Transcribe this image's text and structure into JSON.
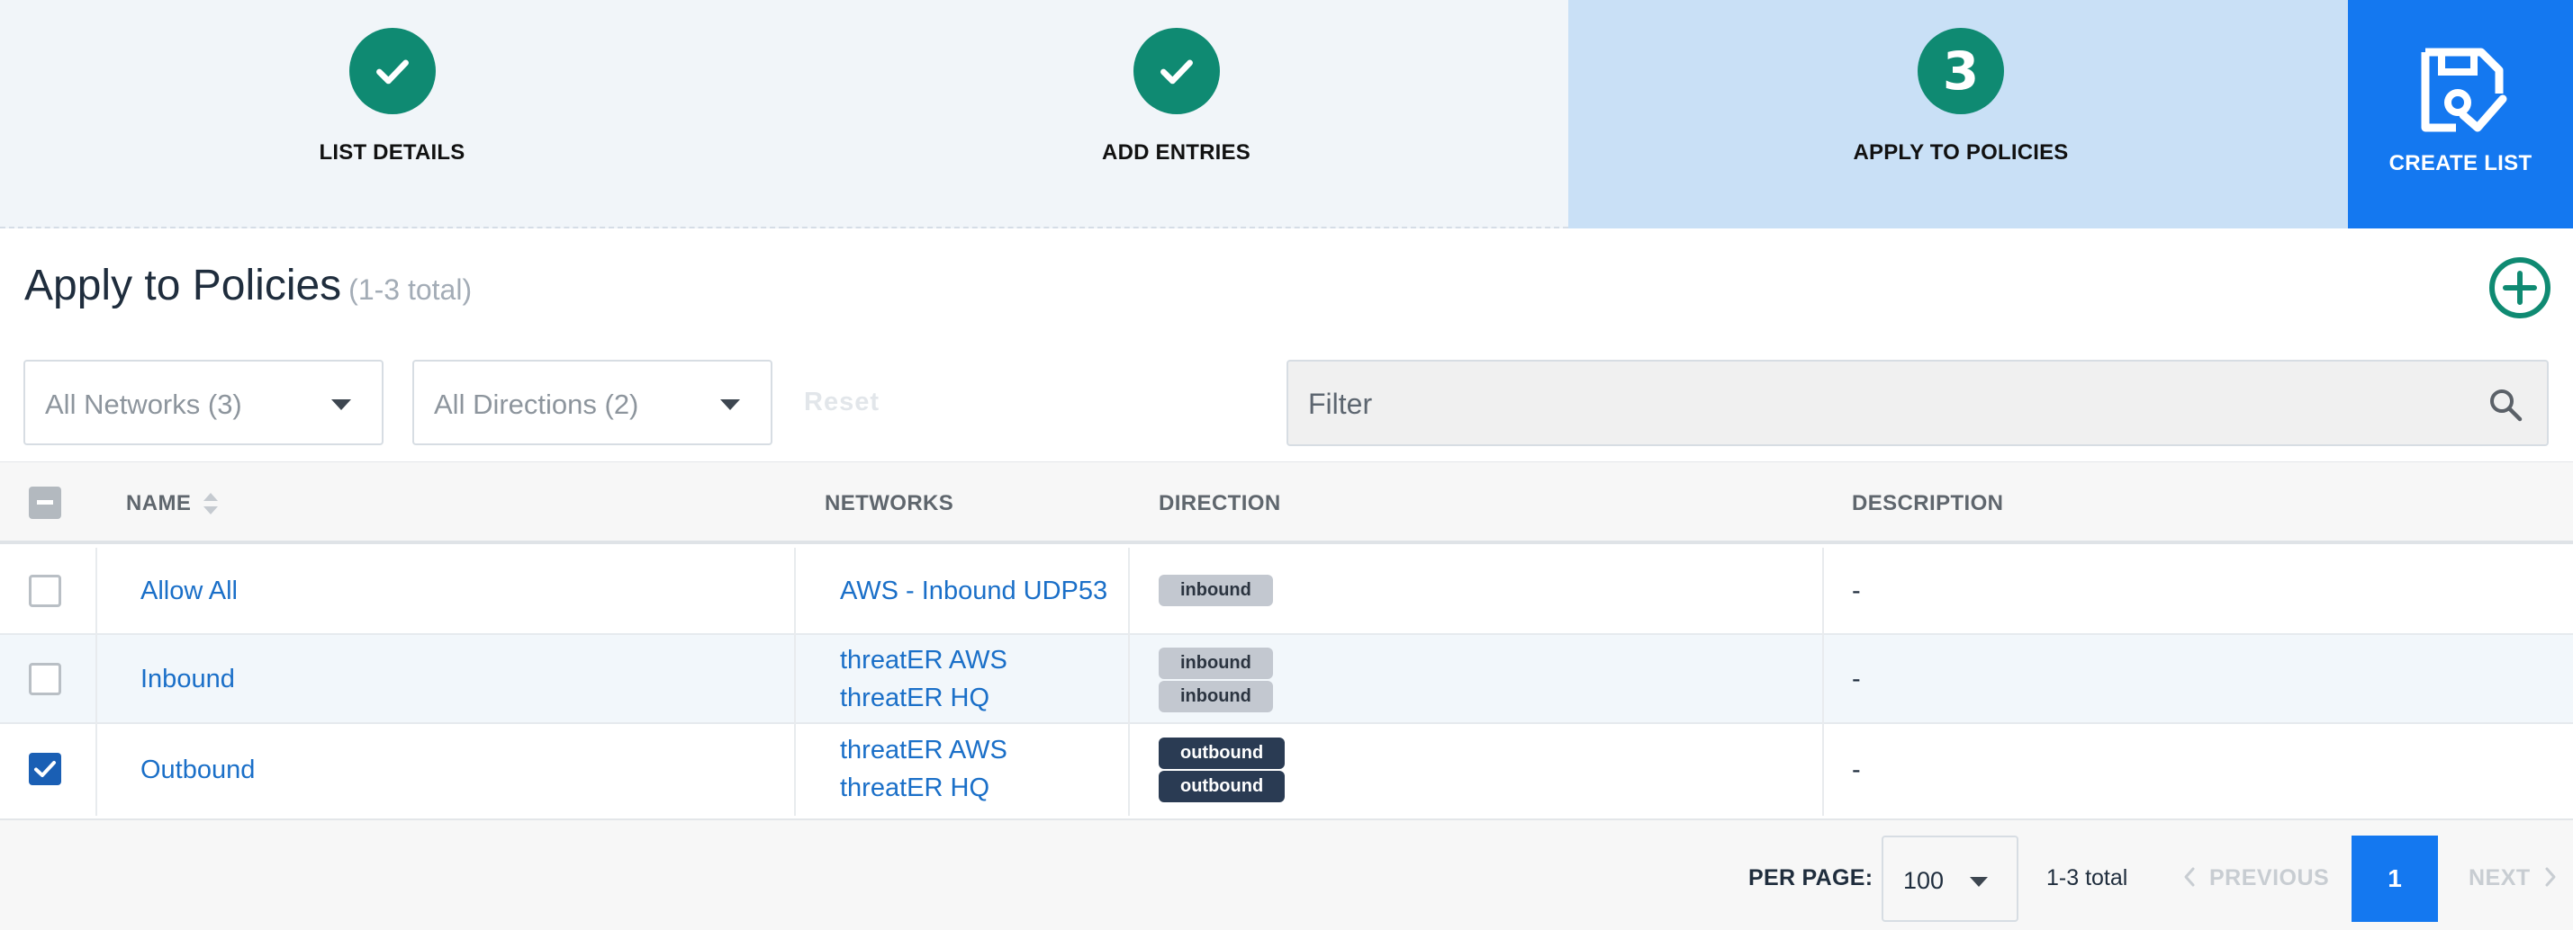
{
  "stepper": {
    "steps": [
      {
        "label": "LIST DETAILS",
        "state": "complete"
      },
      {
        "label": "ADD ENTRIES",
        "state": "complete"
      },
      {
        "label": "APPLY TO POLICIES",
        "state": "active",
        "number": "3"
      }
    ],
    "create_button": {
      "label": "CREATE LIST",
      "icon": "save-check-icon"
    }
  },
  "header": {
    "title": "Apply to Policies",
    "count": "(1-3 total)",
    "add_icon": "plus-circle-icon"
  },
  "filters": {
    "networks": "All Networks (3)",
    "directions": "All Directions (2)",
    "reset": "Reset",
    "search_placeholder": "Filter",
    "search_icon": "search-icon"
  },
  "table": {
    "columns": {
      "name": "NAME",
      "networks": "NETWORKS",
      "direction": "DIRECTION",
      "description": "DESCRIPTION"
    },
    "rows": [
      {
        "checked": false,
        "name": "Allow All",
        "networks": [
          "AWS - Inbound UDP53"
        ],
        "directions": [
          "inbound"
        ],
        "description": "-"
      },
      {
        "checked": false,
        "name": "Inbound",
        "networks": [
          "threatER AWS",
          "threatER HQ"
        ],
        "directions": [
          "inbound",
          "inbound"
        ],
        "description": "-"
      },
      {
        "checked": true,
        "name": "Outbound",
        "networks": [
          "threatER AWS",
          "threatER HQ"
        ],
        "directions": [
          "outbound",
          "outbound"
        ],
        "description": "-"
      }
    ]
  },
  "pagination": {
    "per_page_label": "PER PAGE:",
    "per_page_value": "100",
    "total": "1-3 total",
    "previous": "PREVIOUS",
    "current_page": "1",
    "next": "NEXT"
  },
  "colors": {
    "accent": "#1478f0",
    "step_complete": "#0f8a72",
    "step_active_bg": "#c9e0f6",
    "link": "#1a6fc8",
    "badge_inbound": "#c3c8d0",
    "badge_outbound": "#2a3b53"
  }
}
